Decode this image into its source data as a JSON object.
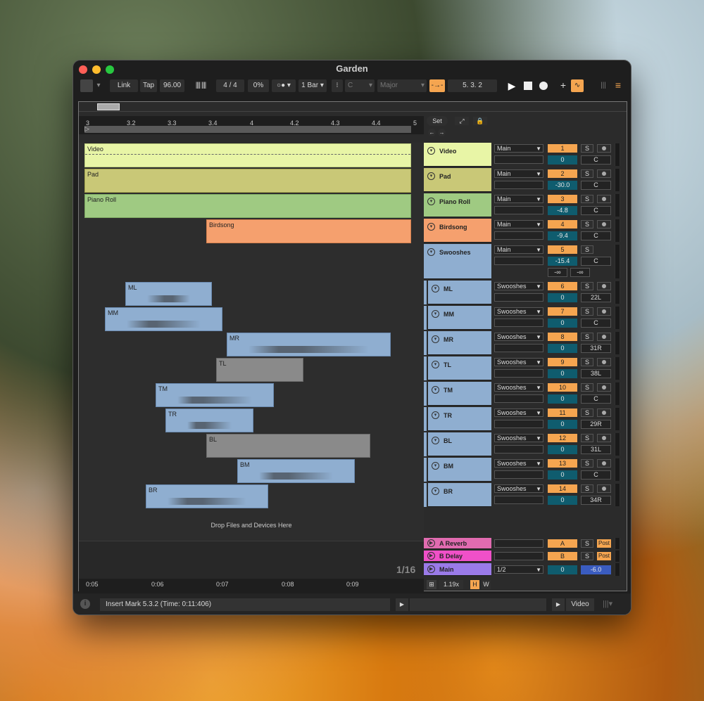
{
  "window": {
    "title": "Garden"
  },
  "colors": {
    "accent": "#f5a550",
    "video": "#e8f5a6",
    "pad": "#c9c877",
    "piano": "#9fca82",
    "birdsong": "#f5a06e",
    "swooshes": "#8faed0",
    "gray_clip": "#8a8a8a",
    "reverb": "#e16bb0",
    "delay": "#f050c8",
    "main": "#9a7ae8",
    "volume": "#0f5c6e"
  },
  "toolbar": {
    "link": "Link",
    "tap": "Tap",
    "tempo": "96.00",
    "time_sig": "4 / 4",
    "groove": "0%",
    "quantize": "1 Bar",
    "key": "C",
    "scale": "Major",
    "position": "5.  3.  2"
  },
  "ruler": {
    "bars": [
      "3",
      "3.2",
      "3.3",
      "3.4",
      "4",
      "4.2",
      "4.3",
      "4.4",
      "5"
    ]
  },
  "scene_controls": {
    "set_label": "Set"
  },
  "timeline": {
    "times": [
      "0:05",
      "0:06",
      "0:07",
      "0:08",
      "0:09"
    ],
    "grid": "1/16",
    "drop_hint": "Drop Files and Devices Here"
  },
  "tracks": [
    {
      "name": "Video",
      "output": "Main",
      "number": "1",
      "volume": "0",
      "pan": "C"
    },
    {
      "name": "Pad",
      "output": "Main",
      "number": "2",
      "volume": "-30.0",
      "pan": "C"
    },
    {
      "name": "Piano Roll",
      "output": "Main",
      "number": "3",
      "volume": "-4.8",
      "pan": "C"
    },
    {
      "name": "Birdsong",
      "output": "Main",
      "number": "4",
      "volume": "-9.4",
      "pan": "C"
    },
    {
      "name": "Swooshes",
      "output": "Main",
      "number": "5",
      "volume": "-15.4",
      "pan": "C",
      "send_a": "-∞",
      "send_b": "-∞"
    },
    {
      "name": "ML",
      "output": "Swooshes",
      "number": "6",
      "volume": "0",
      "pan": "22L"
    },
    {
      "name": "MM",
      "output": "Swooshes",
      "number": "7",
      "volume": "0",
      "pan": "C"
    },
    {
      "name": "MR",
      "output": "Swooshes",
      "number": "8",
      "volume": "0",
      "pan": "31R"
    },
    {
      "name": "TL",
      "output": "Swooshes",
      "number": "9",
      "volume": "0",
      "pan": "38L"
    },
    {
      "name": "TM",
      "output": "Swooshes",
      "number": "10",
      "volume": "0",
      "pan": "C"
    },
    {
      "name": "TR",
      "output": "Swooshes",
      "number": "11",
      "volume": "0",
      "pan": "29R"
    },
    {
      "name": "BL",
      "output": "Swooshes",
      "number": "12",
      "volume": "0",
      "pan": "31L"
    },
    {
      "name": "BM",
      "output": "Swooshes",
      "number": "13",
      "volume": "0",
      "pan": "C"
    },
    {
      "name": "BR",
      "output": "Swooshes",
      "number": "14",
      "volume": "0",
      "pan": "34R"
    }
  ],
  "returns": [
    {
      "name": "A Reverb",
      "letter": "A",
      "mode": "Post"
    },
    {
      "name": "B Delay",
      "letter": "B",
      "mode": "Post"
    }
  ],
  "master": {
    "name": "Main",
    "cue": "1/2",
    "volume": "0",
    "pan": "-6.0"
  },
  "footer": {
    "zoom": "1.19x",
    "h": "H",
    "w": "W"
  },
  "status": {
    "message": "Insert Mark 5.3.2 (Time: 0:11:406)",
    "right_label": "Video"
  }
}
